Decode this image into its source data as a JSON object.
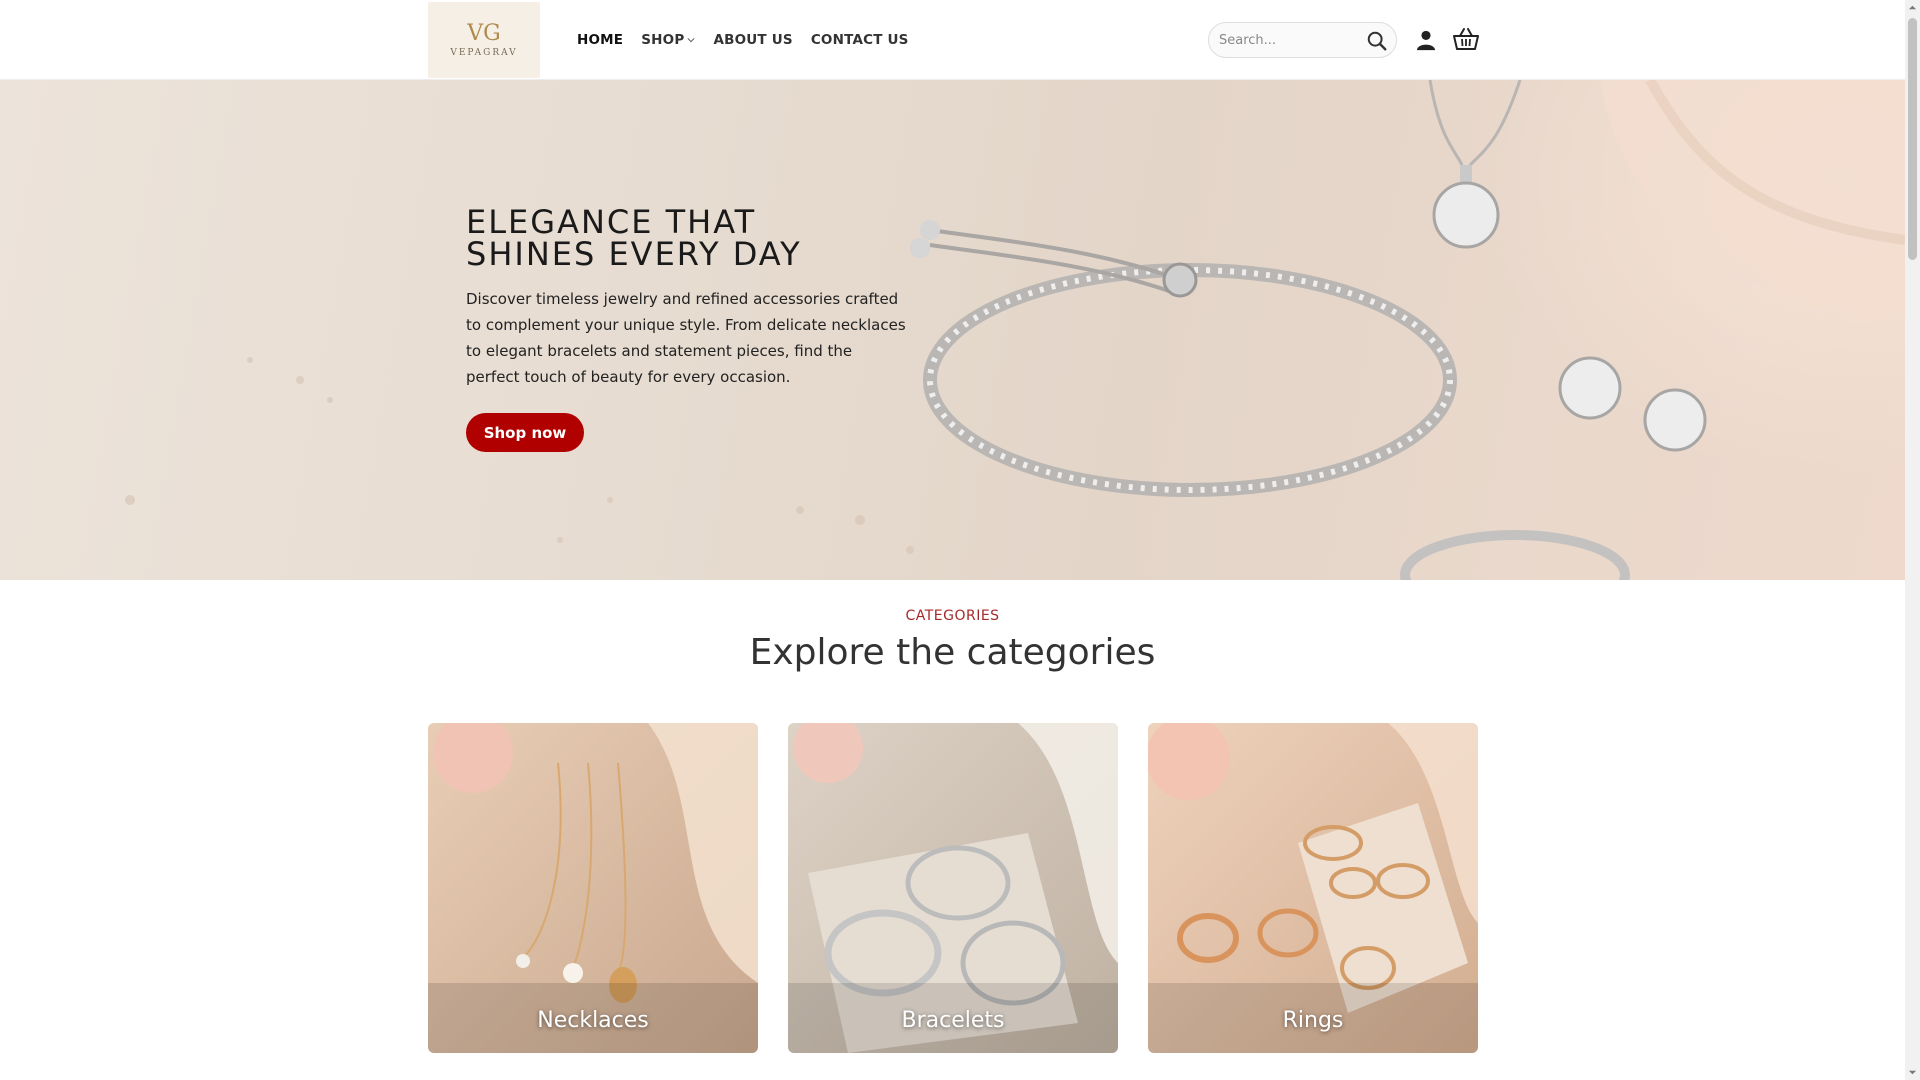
{
  "brand": {
    "mark": "VG",
    "name": "VEPAGRAV"
  },
  "nav": {
    "items": [
      {
        "label": "HOME"
      },
      {
        "label": "SHOP"
      },
      {
        "label": "ABOUT US"
      },
      {
        "label": "CONTACT US"
      }
    ]
  },
  "search": {
    "placeholder": "Search..."
  },
  "hero": {
    "title_line1": "ELEGANCE THAT",
    "title_line2": "SHINES EVERY DAY",
    "description": "Discover timeless jewelry and refined accessories crafted to complement your unique style. From delicate necklaces to elegant bracelets and statement pieces, find the perfect touch of beauty for every occasion.",
    "button_label": "Shop now"
  },
  "categories": {
    "eyebrow": "CATEGORIES",
    "title": "Explore the categories",
    "items": [
      {
        "label": "Necklaces"
      },
      {
        "label": "Bracelets"
      },
      {
        "label": "Rings"
      }
    ]
  },
  "colors": {
    "accent": "#b00000",
    "eyebrow": "#a52a2a"
  },
  "icons": [
    "search-icon",
    "user-icon",
    "cart-icon",
    "chevron-down-icon"
  ]
}
